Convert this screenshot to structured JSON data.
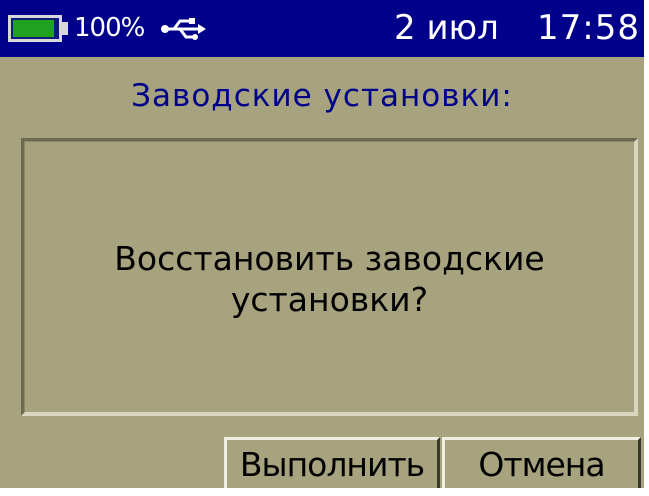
{
  "status": {
    "battery_percent": "100%",
    "battery_level": 1.0,
    "date": "2 июл",
    "time": "17:58",
    "icons": [
      "battery-icon",
      "usb-icon"
    ]
  },
  "title": "Заводские установки:",
  "dialog": {
    "message_line1": "Восстановить заводские",
    "message_line2": "установки?"
  },
  "buttons": {
    "execute_label": "Выполнить",
    "cancel_label": "Отмена"
  },
  "colors": {
    "screen_bg": "#a7a37f",
    "statusbar_bg": "#00008b",
    "title_text": "#00008b",
    "battery_fill": "#1fa31f"
  }
}
